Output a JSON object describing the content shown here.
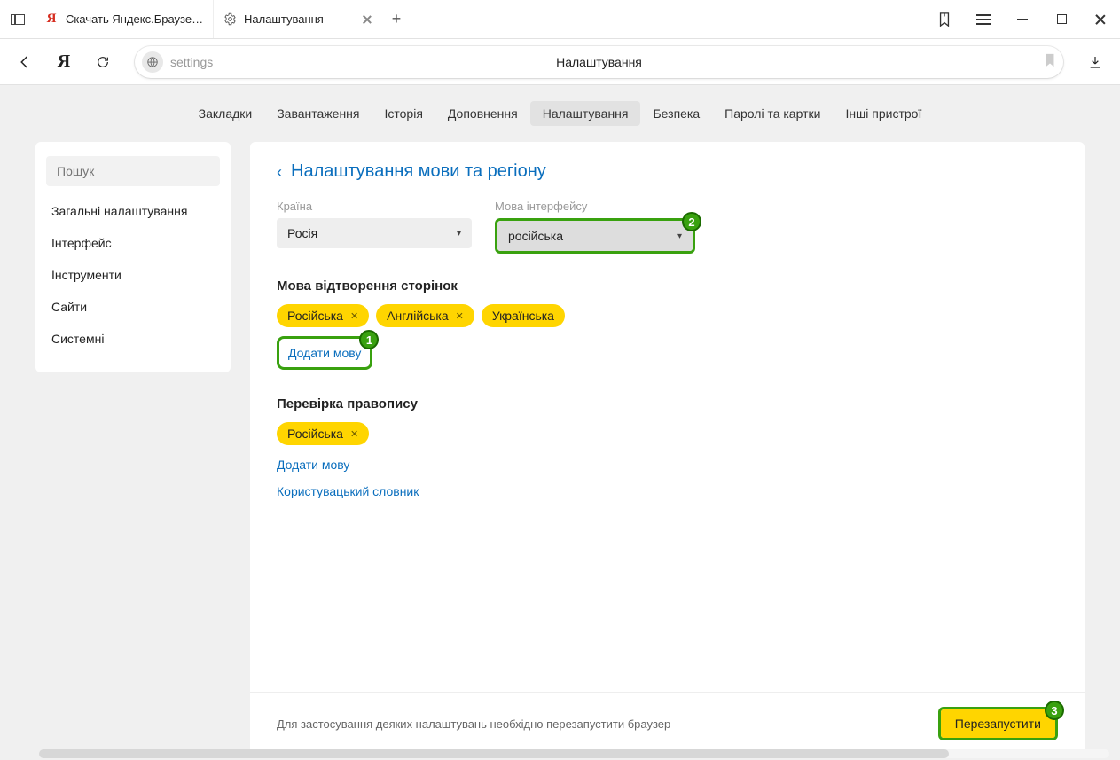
{
  "tabs": [
    {
      "title": "Скачать Яндекс.Браузер д",
      "favicon": "yandex"
    },
    {
      "title": "Налаштування",
      "favicon": "gear",
      "active": true
    }
  ],
  "address": {
    "url": "settings",
    "title": "Налаштування"
  },
  "topnav": {
    "items": [
      "Закладки",
      "Завантаження",
      "Історія",
      "Доповнення",
      "Налаштування",
      "Безпека",
      "Паролі та картки",
      "Інші пристрої"
    ],
    "activeIndex": 4
  },
  "sidebar": {
    "search_placeholder": "Пошук",
    "items": [
      "Загальні налаштування",
      "Інтерфейс",
      "Інструменти",
      "Сайти",
      "Системні"
    ]
  },
  "main": {
    "page_title": "Налаштування мови та регіону",
    "country": {
      "label": "Країна",
      "value": "Росія"
    },
    "ui_lang": {
      "label": "Мова інтерфейсу",
      "value": "російська"
    },
    "page_lang_section": {
      "title": "Мова відтворення сторінок",
      "chips": [
        "Російська",
        "Англійська",
        "Українська"
      ],
      "add_label": "Додати мову"
    },
    "spell_section": {
      "title": "Перевірка правопису",
      "chips": [
        "Російська"
      ],
      "add_label": "Додати мову",
      "dict_label": "Користувацький словник"
    },
    "footer": {
      "text": "Для застосування деяких налаштувань необхідно перезапустити браузер",
      "restart": "Перезапустити"
    }
  },
  "badges": {
    "add_lang": "1",
    "ui_lang": "2",
    "restart": "3"
  }
}
